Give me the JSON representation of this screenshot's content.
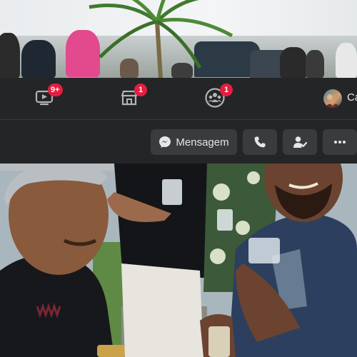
{
  "nav": {
    "watch_badge": "9+",
    "marketplace_badge": "1",
    "groups_badge": "1",
    "profile_name": "Ca"
  },
  "actions": {
    "message_label": "Mensagem"
  },
  "colors": {
    "background": "#18191a",
    "surface": "#242526",
    "button": "#3a3b3c",
    "badge": "#e41e3f",
    "messenger_blue": "#0084ff",
    "text": "#e4e6eb"
  },
  "icons": {
    "watch": "watch-icon",
    "marketplace": "marketplace-icon",
    "groups": "groups-icon",
    "messenger": "messenger-icon",
    "phone": "phone-icon",
    "friends": "friends-icon",
    "more": "more-icon"
  }
}
